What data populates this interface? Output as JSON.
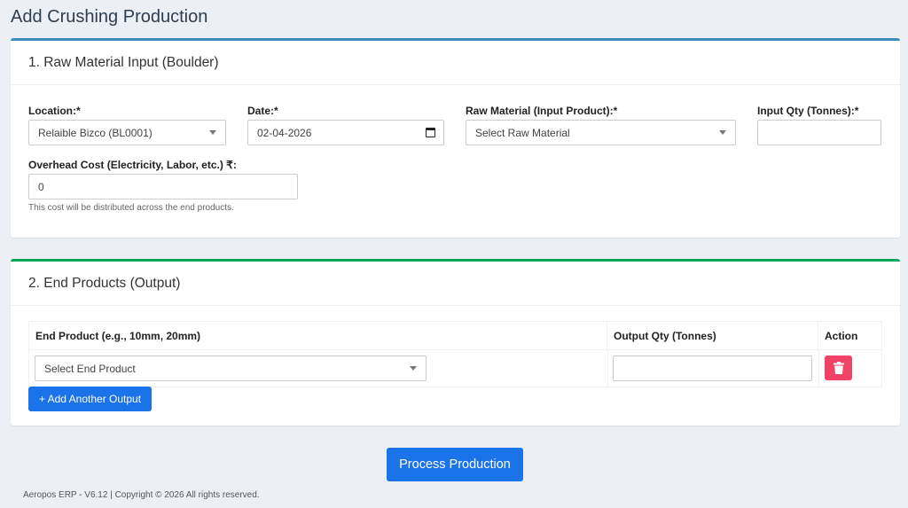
{
  "page_title": "Add Crushing Production",
  "section1": {
    "title": "1. Raw Material Input (Boulder)",
    "location_label": "Location:*",
    "location_value": "Relaible Bizco (BL0001)",
    "date_label": "Date:*",
    "date_value": "02-04-2026",
    "raw_material_label": "Raw Material (Input Product):*",
    "raw_material_value": "Select Raw Material",
    "input_qty_label": "Input Qty (Tonnes):*",
    "input_qty_value": "",
    "overhead_label": "Overhead Cost (Electricity, Labor, etc.) ₹:",
    "overhead_value": "0",
    "overhead_help": "This cost will be distributed across the end products."
  },
  "section2": {
    "title": "2. End Products (Output)",
    "columns": [
      "End Product (e.g., 10mm, 20mm)",
      "Output Qty (Tonnes)",
      "Action"
    ],
    "rows": [
      {
        "end_product": "Select End Product",
        "output_qty": ""
      }
    ],
    "add_button": "+ Add Another Output"
  },
  "process_button": "Process Production",
  "footer": "Aeropos ERP - V6.12 | Copyright © 2026 All rights reserved.",
  "colors": {
    "primary": "#1a73e8",
    "danger": "#f04366",
    "section1_accent": "#3c8dbc",
    "section2_accent": "#00a65a"
  },
  "icons": {
    "delete": "trash-icon",
    "select": "chevron-down-icon",
    "date": "calendar-icon"
  }
}
